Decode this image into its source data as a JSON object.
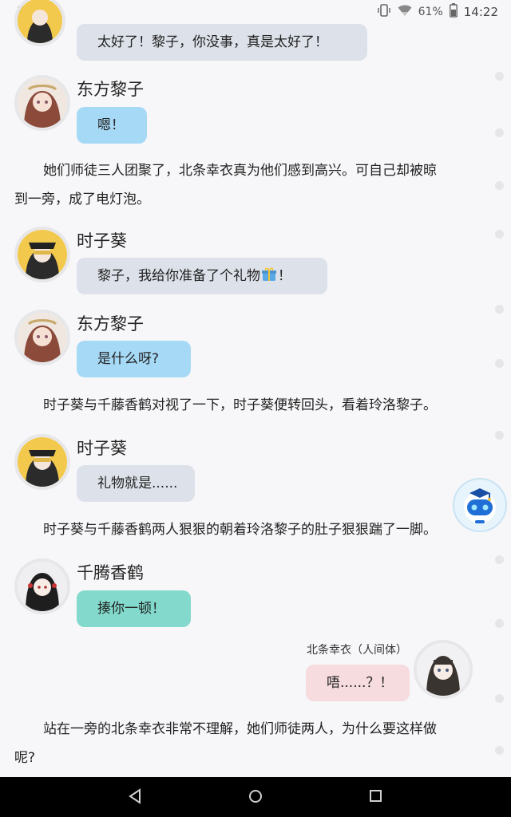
{
  "status_bar": {
    "battery_percent": "61%",
    "time": "14:22",
    "icons": [
      "bell-icon",
      "image-icon",
      "vibrate-icon",
      "wifi-icon",
      "battery-icon"
    ]
  },
  "messages": {
    "m1_text": "太好了！黎子，你没事，真是太好了！",
    "m2_name": "东方黎子",
    "m2_text": "嗯！",
    "n1_line1": "她们师徒三人团聚了，北条幸衣真为他们感到高兴。可自己却被晾",
    "n1_line2": "到一旁，成了电灯泡。",
    "m3_name": "时子葵",
    "m3_text_before": "黎子，我给你准备了个礼物",
    "m3_text_after": "！",
    "m4_name": "东方黎子",
    "m4_text": "是什么呀?",
    "n2_line1": "时子葵与千藤香鹤对视了一下，时子葵便转回头，看着玲洛黎子。",
    "m5_name": "时子葵",
    "m5_text": "礼物就是......",
    "n3_line1": "时子葵与千藤香鹤两人狠狠的朝着玲洛黎子的肚子狠狠踹了一脚。",
    "m6_name": "千腾香鹤",
    "m6_text": "揍你一顿！",
    "m7_name": "北条幸衣（人间体）",
    "m7_text": "唔......？！",
    "n4_line1": "站在一旁的北条幸衣非常不理解，她们师徒两人，为什么要这样做",
    "n4_line2": "呢?"
  },
  "colors": {
    "bubble_gray": "#dde2ea",
    "bubble_blue": "#a6d9f6",
    "bubble_teal": "#82d9cc",
    "bubble_pink": "#f6dcdf"
  },
  "nav": {
    "icons": [
      "back-icon",
      "home-icon",
      "recents-icon"
    ]
  }
}
